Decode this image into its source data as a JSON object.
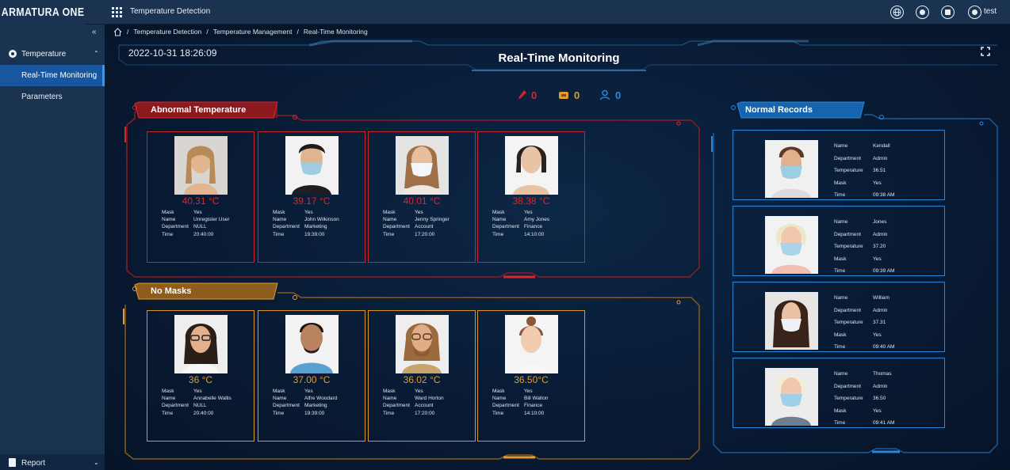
{
  "app": {
    "logo": "ARMATURA ONE",
    "title": "Temperature Detection",
    "user": "test"
  },
  "topbar_icons": [
    "globe-icon",
    "bell-icon",
    "lock-icon",
    "user-icon"
  ],
  "sidebar": {
    "collapse_label": "«",
    "group_label": "Temperature",
    "group_chevron": "⌃",
    "items": [
      {
        "label": "Real-Time Monitoring",
        "active": true
      },
      {
        "label": "Parameters",
        "active": false
      }
    ],
    "footer_label": "Report",
    "footer_chevron": "⌄"
  },
  "breadcrumb": {
    "sep": "/",
    "items": [
      "Temperature Detection",
      "Temperature Management",
      "Real-Time Monitoring"
    ]
  },
  "header": {
    "timestamp": "2022-10-31 18:26:09",
    "title": "Real-Time Monitoring"
  },
  "counters": {
    "abnormal": "0",
    "no_mask": "0",
    "normal": "0"
  },
  "colors": {
    "red": "#d9272d",
    "orange": "#e09b31",
    "blue": "#2a87d8"
  },
  "abnormal": {
    "label": "Abnormal Temperature",
    "field_labels": {
      "mask": "Mask",
      "name": "Name",
      "department": "Department",
      "time": "Time"
    },
    "cards": [
      {
        "temp": "40.31 °C",
        "mask": "Yes",
        "name": "Unregister User",
        "department": "NULL",
        "time": "20:40:00"
      },
      {
        "temp": "39.17 °C",
        "mask": "Yes",
        "name": "John Wilkinson",
        "department": "Marketing",
        "time": "19:39:00"
      },
      {
        "temp": "40.01 °C",
        "mask": "Yes",
        "name": "Jenny Springer",
        "department": "Account",
        "time": "17:20:00"
      },
      {
        "temp": "38.38 °C",
        "mask": "Yes",
        "name": "Amy Jones",
        "department": "Finance",
        "time": "14:10:00"
      }
    ]
  },
  "no_masks": {
    "label": "No Masks",
    "field_labels": {
      "mask": "Mask",
      "name": "Name",
      "department": "Department",
      "time": "Time"
    },
    "cards": [
      {
        "temp": "36 °C",
        "mask": "Yes",
        "name": "Annabelle Wallis",
        "department": "NULL",
        "time": "20:40:00"
      },
      {
        "temp": "37.00 °C",
        "mask": "Yes",
        "name": "Alfre Woodard",
        "department": "Marketing",
        "time": "19:39:00"
      },
      {
        "temp": "36.02 °C",
        "mask": "Yes",
        "name": "Ward Horton",
        "department": "Account",
        "time": "17:20:00"
      },
      {
        "temp": "36.50°C",
        "mask": "Yes",
        "name": "Bill Walton",
        "department": "Finance",
        "time": "14:10:00"
      }
    ]
  },
  "normal": {
    "label": "Normal Records",
    "field_labels": {
      "name": "Name",
      "department": "Department",
      "temperature": "Temperature",
      "mask": "Mask",
      "time": "Time"
    },
    "records": [
      {
        "name": "Kendall",
        "department": "Admin",
        "temperature": "36.51",
        "mask": "Yes",
        "time": "09:38 AM"
      },
      {
        "name": "Jones",
        "department": "Admin",
        "temperature": "37.20",
        "mask": "Yes",
        "time": "09:39 AM"
      },
      {
        "name": "William",
        "department": "Admin",
        "temperature": "37.31",
        "mask": "Yes",
        "time": "09:40 AM"
      },
      {
        "name": "Thomas",
        "department": "Admin",
        "temperature": "36.50",
        "mask": "Yes",
        "time": "09:41 AM"
      }
    ]
  }
}
